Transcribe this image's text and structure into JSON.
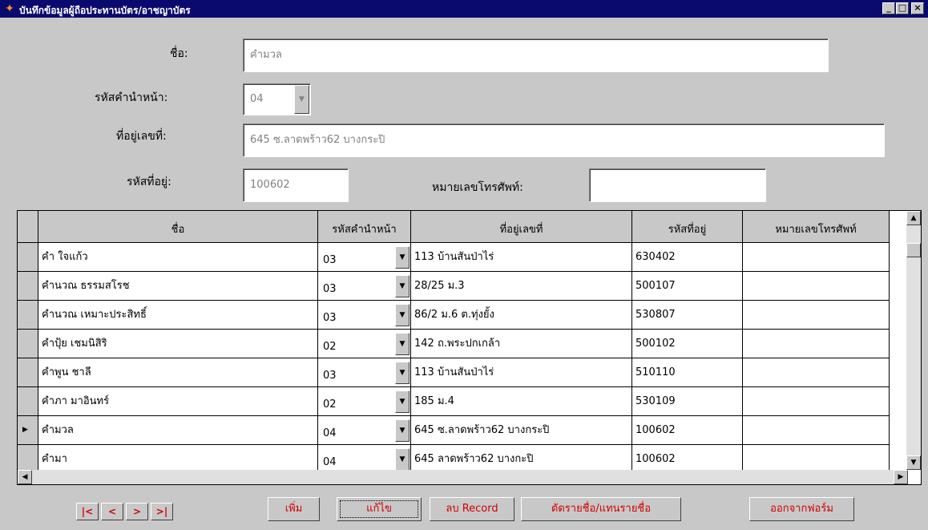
{
  "window": {
    "title": "บันทึกข้อมูลผู้ถือประทานบัตร/อาชญาบัตร",
    "controls": [
      "_",
      "□",
      "×"
    ]
  },
  "form": {
    "name_label": "ชื่อ:",
    "name_value": "คำมวล",
    "prefix_label": "รหัสคำนำหน้า:",
    "prefix_value": "04",
    "address_label": "ที่อยู่เลขที่:",
    "address_value": "645 ซ.ลาดพร้าว62 บางกระปิ",
    "addrcode_label": "รหัสที่อยู่:",
    "addrcode_value": "100602",
    "phone_label": "หมายเลขโทรศัพท์:",
    "phone_value": ""
  },
  "grid": {
    "headers": [
      "ชื่อ",
      "รหัสคำนำหน้า",
      "ที่อยู่เลขที่",
      "รหัสที่อยู่",
      "หมายเลขโทรศัพท์"
    ],
    "rows": [
      {
        "name": "คำ ใจแก้ว",
        "prefix": "03",
        "address": "113 บ้านสันป่าไร่",
        "code": "630402",
        "phone": ""
      },
      {
        "name": "คำนวณ ธรรมสโรช",
        "prefix": "03",
        "address": "28/25 ม.3",
        "code": "500107",
        "phone": ""
      },
      {
        "name": "คำนวณ เหมาะประสิทธิ์",
        "prefix": "03",
        "address": "86/2 ม.6 ต.ทุ่งยั้ง",
        "code": "530807",
        "phone": ""
      },
      {
        "name": "คำปุ้ย เชมนิสิริ",
        "prefix": "02",
        "address": "142 ถ.พระปกเกล้า",
        "code": "500102",
        "phone": ""
      },
      {
        "name": "คำพูน ชาลี",
        "prefix": "03",
        "address": "113 บ้านสันป่าไร่",
        "code": "510110",
        "phone": ""
      },
      {
        "name": "คำภา มาอินทร์",
        "prefix": "02",
        "address": "185 ม.4",
        "code": "530109",
        "phone": ""
      },
      {
        "name": "คำมวล",
        "prefix": "04",
        "address": "645 ซ.ลาดพร้าว62 บางกระปิ",
        "code": "100602",
        "phone": ""
      },
      {
        "name": "คำมา",
        "prefix": "04",
        "address": "645 ลาดพร้าว62 บางกะปิ",
        "code": "100602",
        "phone": ""
      }
    ],
    "current_row_marker": "▶"
  },
  "buttons": {
    "first": "|<",
    "prev": "<",
    "next": ">",
    "last": ">|",
    "add": "เพิ่ม",
    "edit": "แก้ไข",
    "delete": "ลบ Record",
    "remove_replace": "ตัดรายชื่อ/แทนรายชื่อ",
    "exit": "ออกจากฟอร์ม"
  }
}
